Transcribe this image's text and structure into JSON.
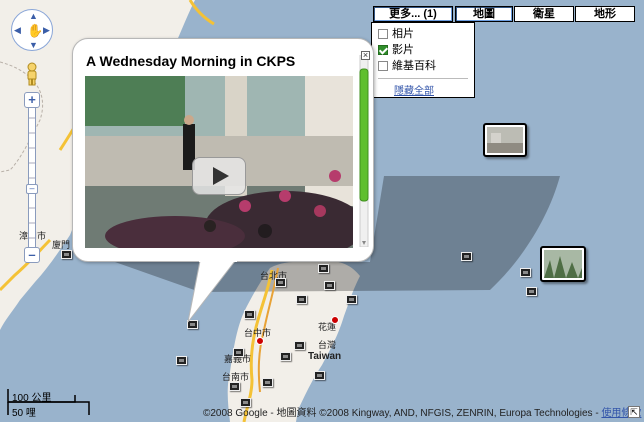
{
  "map_types": {
    "more": "更多... (1)",
    "map": "地圖",
    "satellite": "衛星",
    "terrain": "地形"
  },
  "more_menu": {
    "photos": "相片",
    "videos": "影片",
    "wikipedia": "維基百科",
    "hide_all": "隱藏全部"
  },
  "info_window": {
    "title": "A Wednesday Morning in CKPS"
  },
  "map_labels": {
    "taipei": "台北市",
    "taichung": "台中市",
    "chiayi": "嘉義市",
    "tainan": "台南市",
    "hualien": "花蓮",
    "taiwan_zh": "台灣",
    "taiwan_en": "Taiwan",
    "zhangzhou": "漳州市",
    "xiamen": "廈門"
  },
  "scale": {
    "km": "100 公里",
    "mi": "50 哩"
  },
  "footer": {
    "copyright": "©2008 Google - 地圖資料 ©2008 Kingway, AND, NFGIS, ZENRIN, Europa Technologies - ",
    "terms": "使用條款"
  },
  "colors": {
    "sea": "#99b3cc",
    "land": "#f2efe9",
    "highway": "#f4c236",
    "checkbox_on": "#2f8d2a",
    "link": "#3355aa"
  }
}
